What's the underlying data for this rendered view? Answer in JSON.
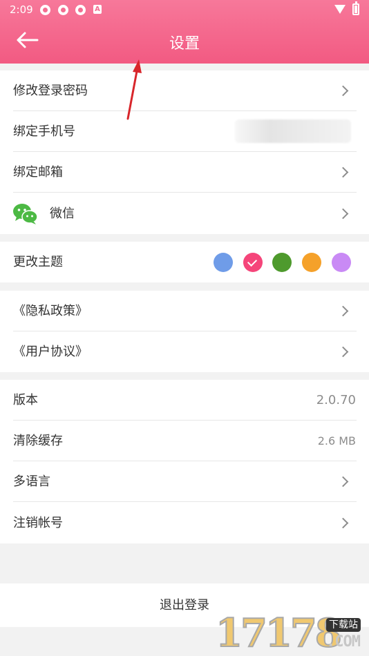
{
  "status": {
    "time": "2:09",
    "a_label": "A"
  },
  "header": {
    "title": "设置"
  },
  "sections": [
    {
      "rows": [
        {
          "label": "修改登录密码"
        },
        {
          "label": "绑定手机号"
        },
        {
          "label": "绑定邮箱"
        },
        {
          "label": "微信"
        }
      ]
    },
    {
      "rows": [
        {
          "label": "更改主题"
        }
      ]
    },
    {
      "rows": [
        {
          "label": "《隐私政策》"
        },
        {
          "label": "《用户协议》"
        }
      ]
    },
    {
      "rows": [
        {
          "label": "版本",
          "value": "2.0.70"
        },
        {
          "label": "清除缓存",
          "value": "2.6 MB"
        },
        {
          "label": "多语言"
        },
        {
          "label": "注销帐号"
        }
      ]
    }
  ],
  "theme_colors": [
    {
      "color": "#6f9ce8",
      "selected": false
    },
    {
      "color": "#f5457a",
      "selected": true
    },
    {
      "color": "#4e9a2d",
      "selected": false
    },
    {
      "color": "#f5a12a",
      "selected": false
    },
    {
      "color": "#c98af5",
      "selected": false
    }
  ],
  "logout_label": "退出登录",
  "watermark": {
    "number": "17178",
    "tag": "下载站",
    "domain": ".COM"
  },
  "icons": {
    "back": "arrow-left-icon",
    "chevron": "chevron-right-icon",
    "wechat": "wechat-icon"
  }
}
